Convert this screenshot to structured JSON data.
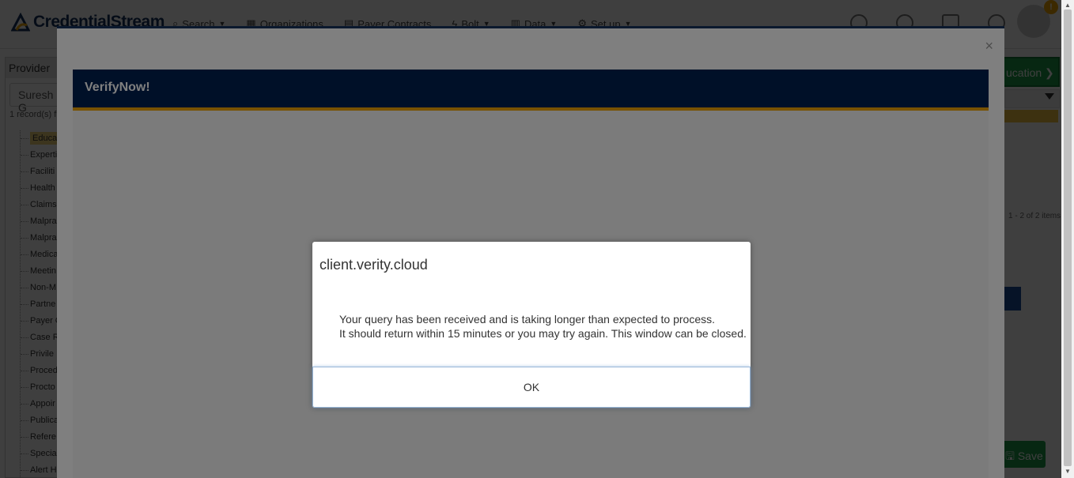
{
  "app": {
    "logo_text": "CredentialStream",
    "nav": [
      {
        "label": "Search",
        "icon": "search-icon"
      },
      {
        "label": "Organizations",
        "icon": "building-icon"
      },
      {
        "label": "Payer Contracts",
        "icon": "document-icon"
      },
      {
        "label": "Bolt",
        "icon": "bolt-icon"
      },
      {
        "label": "Data",
        "icon": "database-icon"
      },
      {
        "label": "Set up",
        "icon": "gears-icon"
      }
    ],
    "notification_count": "!"
  },
  "provider_panel": {
    "title": "Provider",
    "search_value": "Suresh G",
    "records_found": "1 record(s) f",
    "tree_items": [
      "Educat",
      "Experti",
      "Faciliti",
      "Health",
      "Claims",
      "Malpra",
      "Malpra",
      "Medica",
      "Meetin",
      "Non-M",
      "Partne",
      "Payer C",
      "Case R",
      "Privile",
      "Proced",
      "Procto",
      "Appoir",
      "Publica",
      "Refere",
      "Specia",
      "Alert H"
    ]
  },
  "right_panel": {
    "education_label": "ucation",
    "items_count": "1 - 2 of 2 items",
    "save_label": "Save"
  },
  "modal": {
    "close_symbol": "×",
    "header_title": "VerifyNow!"
  },
  "alert": {
    "host": "client.verity.cloud",
    "message_line1": "Your query has been received and is taking longer than expected to process.",
    "message_line2": "It should return within 15 minutes or you may try again. This window can be closed.",
    "ok_label": "OK"
  },
  "colors": {
    "brand_navy": "#002050",
    "accent_gold": "#f0a500",
    "action_green": "#1e9e4a"
  }
}
